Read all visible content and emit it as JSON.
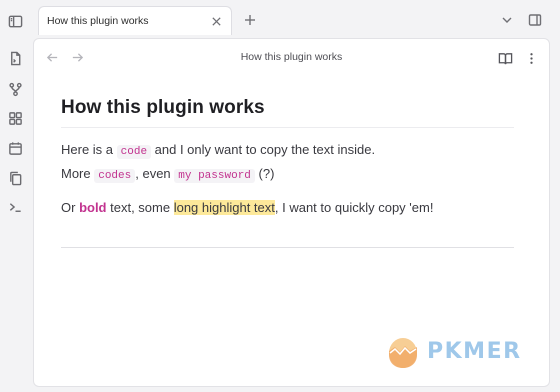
{
  "tab": {
    "title": "How this plugin works"
  },
  "view_header": {
    "title": "How this plugin works"
  },
  "document": {
    "heading": "How this plugin works",
    "line1": {
      "t1": "Here is a ",
      "code1": "code",
      "t2": " and I only want to copy the text inside."
    },
    "line2": {
      "t1": "More ",
      "code1": "codes",
      "t2": ", even ",
      "code2": "my password",
      "t3": " (?)"
    },
    "line3": {
      "t1": "Or ",
      "bold": "bold",
      "t2": " text, some ",
      "highlight": "long highlight text",
      "t3": ", I want to quickly copy 'em!"
    }
  },
  "watermark": {
    "text": "PKMER"
  },
  "colors": {
    "accent_pink": "#c2338f",
    "highlight": "#fde99a",
    "watermark_blue": "#9fc8ea"
  },
  "icons": {
    "ribbon": [
      "sidebar-toggle-icon",
      "file-switcher-icon",
      "graph-icon",
      "blocks-icon",
      "calendar-icon",
      "copy-icon",
      "terminal-icon"
    ],
    "header": [
      "back-arrow-icon",
      "forward-arrow-icon",
      "reading-view-icon",
      "more-options-icon"
    ],
    "tabbar": [
      "close-icon",
      "plus-icon",
      "chevron-down-icon",
      "right-sidebar-toggle-icon"
    ]
  }
}
